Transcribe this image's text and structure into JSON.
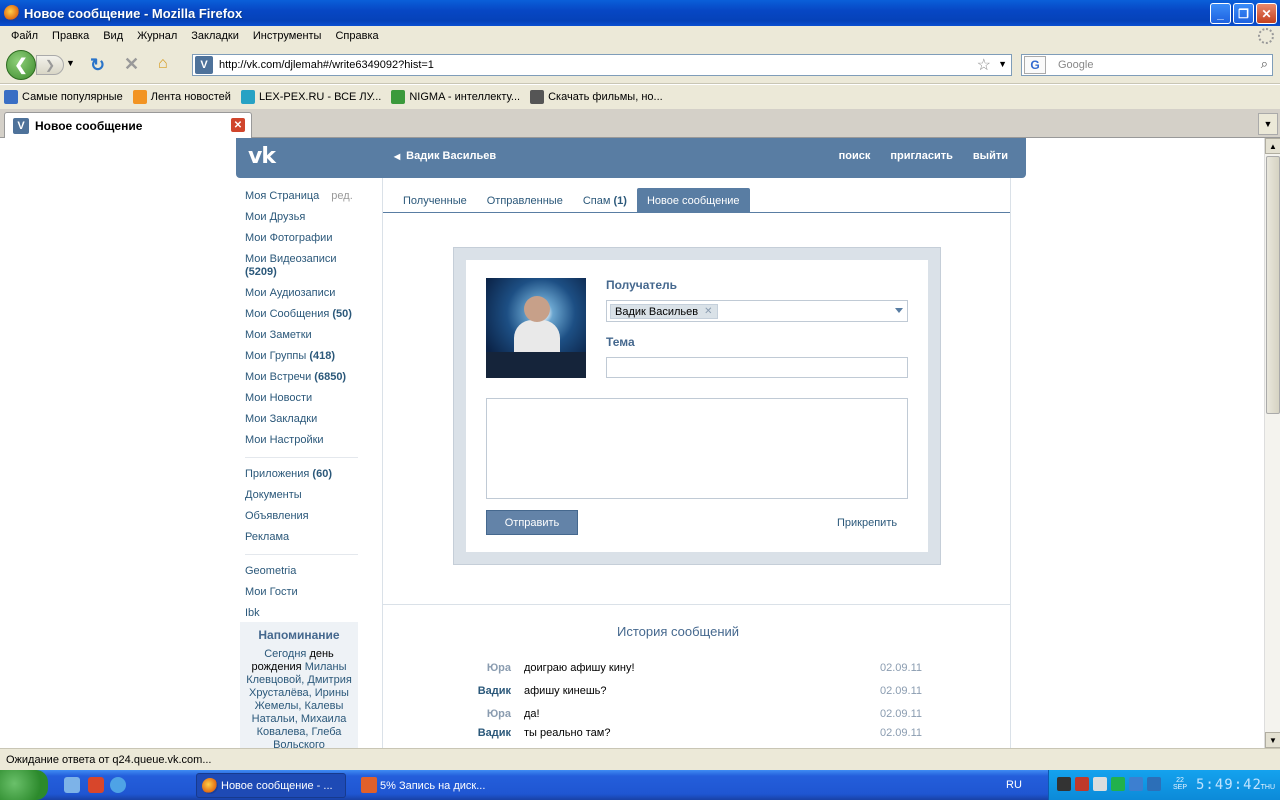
{
  "window": {
    "title": "Новое сообщение - Mozilla Firefox"
  },
  "menu": [
    "Файл",
    "Правка",
    "Вид",
    "Журнал",
    "Закладки",
    "Инструменты",
    "Справка"
  ],
  "nav": {
    "url": "http://vk.com/djlemah#/write6349092?hist=1",
    "search_placeholder": "Google",
    "site_icon_letter": "V"
  },
  "bookmarks": [
    {
      "label": "Самые популярные",
      "icon": "popular-icon",
      "color": "#3a6fc4"
    },
    {
      "label": "Лента новостей",
      "icon": "rss-icon",
      "color": "#f29423"
    },
    {
      "label": "LEX-PEX.RU - ВСЕ ЛУ...",
      "icon": "lexpex-icon",
      "color": "#27a2c4"
    },
    {
      "label": "NIGMA - интеллекту...",
      "icon": "nigma-icon",
      "color": "#3b9a3b"
    },
    {
      "label": "Скачать фильмы, но...",
      "icon": "film-icon",
      "color": "#555555"
    }
  ],
  "tab": {
    "title": "Новое сообщение"
  },
  "vk": {
    "logo": "vk",
    "user_name": "Вадик Васильев",
    "header_links": [
      "поиск",
      "пригласить",
      "выйти"
    ],
    "left_nav": {
      "group1": [
        {
          "label": "Моя Страница",
          "edit": "ред."
        },
        {
          "label": "Мои Друзья"
        },
        {
          "label": "Мои Фотографии"
        },
        {
          "label": "Мои Видеозаписи",
          "count": "(5209)"
        },
        {
          "label": "Мои Аудиозаписи"
        },
        {
          "label": "Мои Сообщения",
          "count": "(50)"
        },
        {
          "label": "Мои Заметки"
        },
        {
          "label": "Мои Группы",
          "count": "(418)"
        },
        {
          "label": "Мои Встречи",
          "count": "(6850)"
        },
        {
          "label": "Мои Новости"
        },
        {
          "label": "Мои Закладки"
        },
        {
          "label": "Мои Настройки"
        }
      ],
      "group2": [
        {
          "label": "Приложения",
          "count": "(60)"
        },
        {
          "label": "Документы"
        },
        {
          "label": "Объявления"
        },
        {
          "label": "Реклама"
        }
      ],
      "group3": [
        {
          "label": "Geometria"
        },
        {
          "label": "Мои Гости"
        },
        {
          "label": "Ibk"
        }
      ]
    },
    "reminder": {
      "title": "Напоминание",
      "today": "Сегодня",
      "birthday": "день рождения",
      "names": "Миланы Клевцовой, Дмитрия Хрусталёва, Ирины Жемелы, Калевы Натальи, Михаила Ковалева, Глеба Вольского"
    },
    "tabs": [
      {
        "label": "Полученные"
      },
      {
        "label": "Отправленные"
      },
      {
        "label": "Спам",
        "count": "(1)"
      },
      {
        "label": "Новое сообщение",
        "active": true
      }
    ],
    "form": {
      "recipient_label": "Получатель",
      "recipient_value": "Вадик Васильев",
      "subject_label": "Тема",
      "subject_value": "",
      "message_value": "",
      "send_label": "Отправить",
      "attach_label": "Прикрепить"
    },
    "history": {
      "title": "История сообщений",
      "messages": [
        {
          "from": "Юра",
          "text": "доиграю афишу кину!",
          "date": "02.09.11"
        },
        {
          "from": "Вадик",
          "text": "афишу кинешь?",
          "date": "02.09.11"
        },
        {
          "from": "Юра",
          "text": "да!",
          "date": "02.09.11"
        },
        {
          "from": "Вадик",
          "text": "ты реально там?",
          "date": "02.09.11"
        }
      ]
    }
  },
  "status": {
    "text": "Ожидание ответа от q24.queue.vk.com..."
  },
  "taskbar": {
    "tasks": [
      {
        "label": "Новое сообщение - ...",
        "active": true
      },
      {
        "label": "5% Запись на диск...",
        "active": false
      }
    ],
    "lang": "RU",
    "time": "5:49:42",
    "date_day": "22",
    "date_month": "SEP",
    "date_weekday": "THU"
  },
  "colors": {
    "vk_blue": "#597da3",
    "vk_link": "#2b587a",
    "xp_taskbar": "#245edb"
  }
}
